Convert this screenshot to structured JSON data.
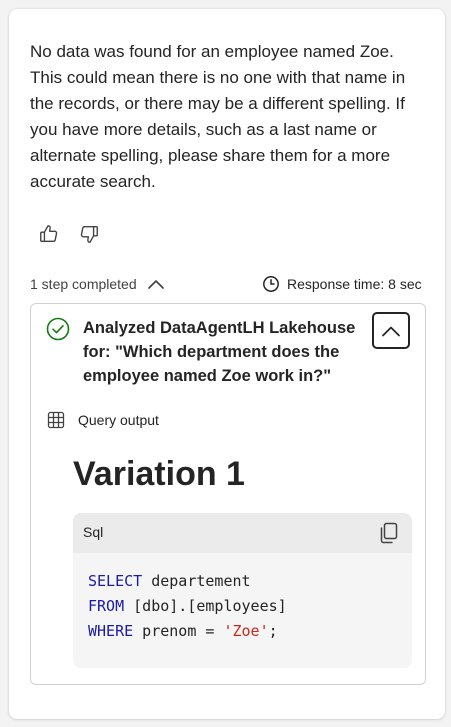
{
  "message": {
    "text": "No data was found for an employee named Zoe. This could mean there is no one with that name in the records, or there may be a different spelling. If you have more details, such as a last name or alternate spelling, please share them for a more accurate search."
  },
  "feedback": {
    "thumbs_up_icon": "thumbs-up-icon",
    "thumbs_down_icon": "thumbs-down-icon"
  },
  "steps": {
    "summary": "1 step completed",
    "response_time": "Response time: 8 sec"
  },
  "step": {
    "title": "Analyzed DataAgentLH Lakehouse for: \"Which department does the employee named Zoe work in?\"",
    "output_label": "Query output",
    "variation_title": "Variation 1",
    "code_language": "Sql",
    "code": {
      "line1_kw": "SELECT",
      "line1_rest": " departement",
      "line2_kw": "FROM",
      "line2_rest": " [dbo].[employees]",
      "line3_kw": "WHERE",
      "line3_mid": " prenom = ",
      "line3_str": "'Zoe'",
      "line3_end": ";"
    }
  },
  "colors": {
    "keyword": "#1a1aa6",
    "string": "#c42b1c",
    "success": "#107c10",
    "card_bg": "#ffffff",
    "page_bg": "#f3f3f3"
  }
}
